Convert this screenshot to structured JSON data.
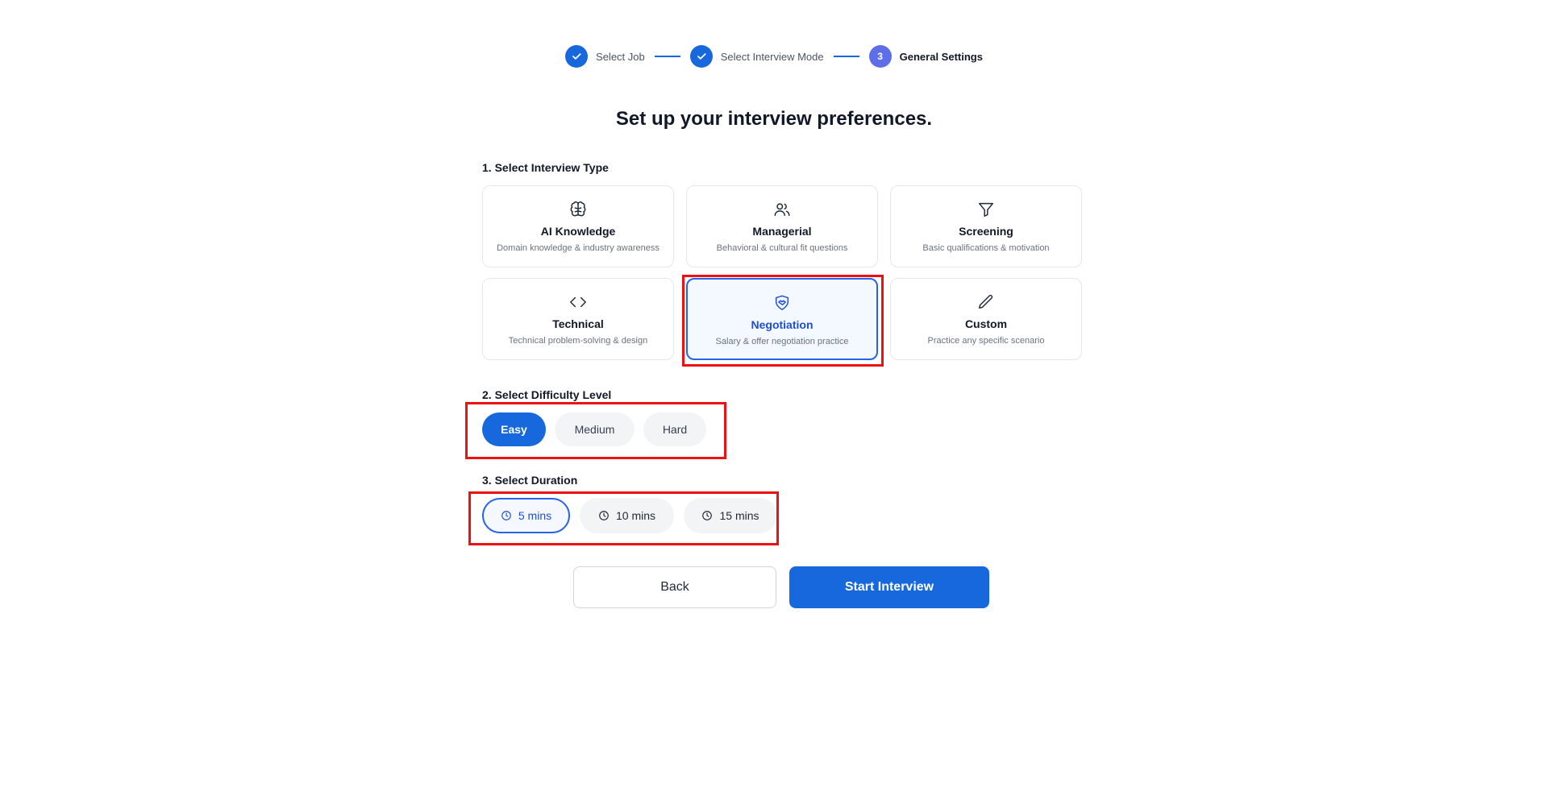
{
  "stepper": {
    "steps": [
      {
        "label": "Select Job",
        "state": "done"
      },
      {
        "label": "Select Interview Mode",
        "state": "done"
      },
      {
        "label": "General Settings",
        "state": "current",
        "number": "3"
      }
    ]
  },
  "page_title": "Set up your interview preferences.",
  "interview_type": {
    "label": "1. Select Interview Type",
    "options": [
      {
        "title": "AI Knowledge",
        "desc": "Domain knowledge & industry awareness",
        "icon": "brain-icon"
      },
      {
        "title": "Managerial",
        "desc": "Behavioral & cultural fit questions",
        "icon": "users-icon"
      },
      {
        "title": "Screening",
        "desc": "Basic qualifications & motivation",
        "icon": "filter-icon"
      },
      {
        "title": "Technical",
        "desc": "Technical problem-solving & design",
        "icon": "code-icon"
      },
      {
        "title": "Negotiation",
        "desc": "Salary & offer negotiation practice",
        "icon": "handshake-icon",
        "selected": true
      },
      {
        "title": "Custom",
        "desc": "Practice any specific scenario",
        "icon": "pencil-icon"
      }
    ]
  },
  "difficulty": {
    "label": "2. Select Difficulty Level",
    "options": [
      "Easy",
      "Medium",
      "Hard"
    ],
    "selected": "Easy"
  },
  "duration": {
    "label": "3. Select Duration",
    "options": [
      "5 mins",
      "10 mins",
      "15 mins"
    ],
    "selected": "5 mins"
  },
  "actions": {
    "back_label": "Back",
    "start_label": "Start Interview"
  },
  "colors": {
    "primary": "#1668dc",
    "highlight": "#ee1111"
  }
}
